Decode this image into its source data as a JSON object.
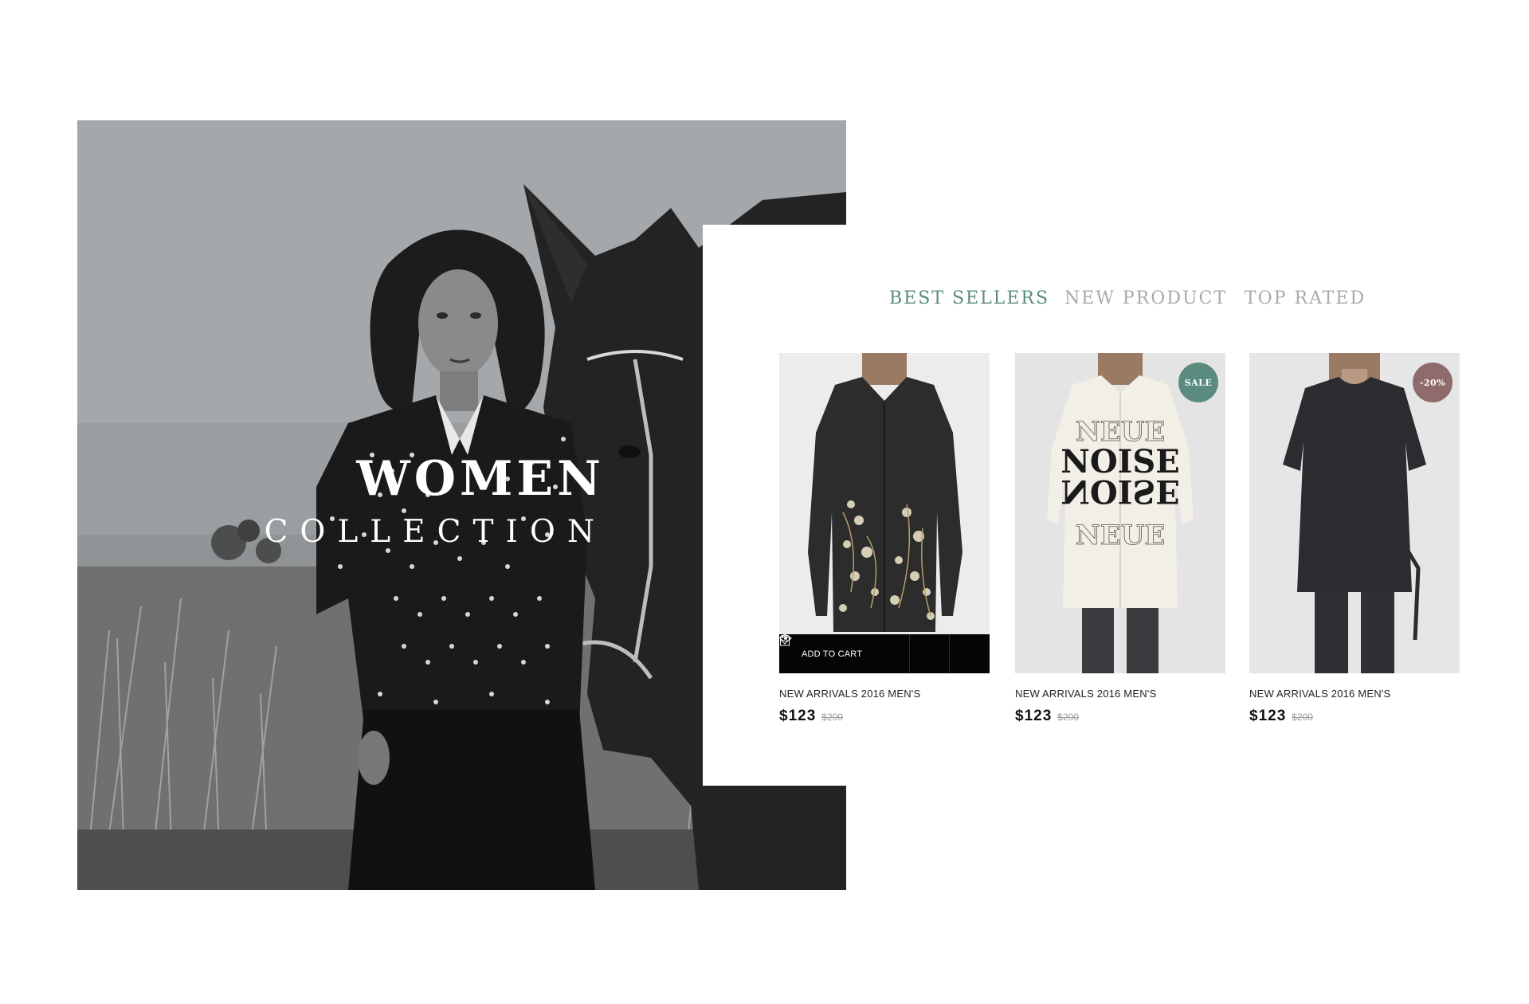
{
  "hero": {
    "title": "WOMEN",
    "subtitle": "COLLECTION",
    "image_icon": "model-with-horse-photo"
  },
  "tabs": [
    {
      "label": "BEST SELLERS",
      "active": true
    },
    {
      "label": "NEW PRODUCT",
      "active": false
    },
    {
      "label": "TOP RATED",
      "active": false
    }
  ],
  "products": [
    {
      "name": "NEW ARRIVALS 2016 MEN'S",
      "price": "$123",
      "old_price": "$200",
      "badge": "",
      "image_icon": "black-floral-shirt-dress-photo"
    },
    {
      "name": "NEW ARRIVALS 2016 MEN'S",
      "price": "$123",
      "old_price": "$200",
      "badge": "SALE",
      "image_icon": "white-noise-print-shirt-photo"
    },
    {
      "name": "NEW ARRIVALS 2016 MEN'S",
      "price": "$123",
      "old_price": "$200",
      "badge": "-20%",
      "image_icon": "dark-tshirt-photo"
    }
  ],
  "actions": {
    "add_to_cart": "ADD TO CART",
    "cart_icon": "cart-icon",
    "wishlist_icon": "heart-icon",
    "quickview_icon": "eye-icon"
  },
  "colors": {
    "accent": "#5a8b7e",
    "inactive_tab": "#a9a9a9",
    "sale_badge": "#5a8b7e",
    "discount_badge": "#8f6b6b",
    "action_bar": "#050505"
  }
}
